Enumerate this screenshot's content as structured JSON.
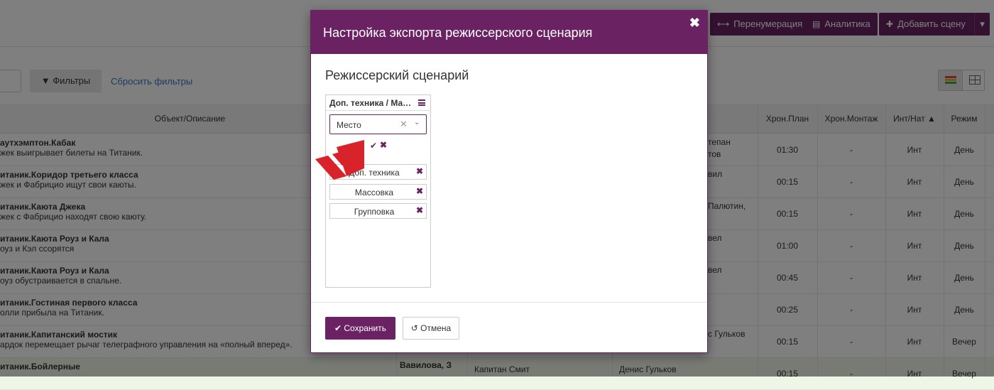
{
  "toolbar": {
    "renumber_label": "Перенумерация",
    "analytics_label": "Аналитика",
    "add_scene_label": "Добавить сцену"
  },
  "filters": {
    "filters_label": "Фильтры",
    "reset_label": "Сбросить фильтры"
  },
  "table": {
    "headers": {
      "object": "Объект/Описание",
      "chron_plan": "Хрон.План",
      "chron_edit": "Хрон.Монтаж",
      "int_nat": "Инт/Нат ▲",
      "mode": "Режим"
    },
    "rows": [
      {
        "title": "аутхэмптон.Кабак",
        "desc": "жек выигрывает билеты на Титаник.",
        "cast": "тепан",
        "cast2": "тов",
        "plan": "01:30",
        "edit": "-",
        "int": "Инт",
        "mode": "День"
      },
      {
        "title": "итаник.Коридор третьего класса",
        "desc": "жек и Фабрицио ищут свои каюты.",
        "cast": "вил",
        "cast2": "",
        "plan": "00:15",
        "edit": "-",
        "int": "Инт",
        "mode": "День"
      },
      {
        "title": "итаник.Каюта Джека",
        "desc": "жек с Фабрицио находят свою каюту.",
        "cast": "Палютин,",
        "cast2": "",
        "plan": "00:15",
        "edit": "-",
        "int": "Инт",
        "mode": "День"
      },
      {
        "title": "итаник.Каюта Роуз и Кала",
        "desc": "оуз и Кэл ссорятся",
        "cast": "вел",
        "cast2": "",
        "plan": "01:00",
        "edit": "-",
        "int": "Инт",
        "mode": "День"
      },
      {
        "title": "итаник.Каюта Роуз и Кала",
        "desc": "оуз обустраивается в спальне.",
        "cast": "вел",
        "cast2": "",
        "plan": "00:45",
        "edit": "-",
        "int": "Инт",
        "mode": "День"
      },
      {
        "title": "итаник.Гостиная первого класса",
        "desc": "олли прибыла на Титаник.",
        "cast": "",
        "cast2": "",
        "plan": "00:25",
        "edit": "-",
        "int": "Инт",
        "mode": "День"
      },
      {
        "title": "итаник.Капитанский мостик",
        "desc": "ардок перемещает рычаг телеграфного управления на «полный вперед».",
        "cast": "с Гульков",
        "cast2": "",
        "plan": "00:15",
        "edit": "-",
        "int": "Инт",
        "mode": "Вечер"
      },
      {
        "title": "итаник.Бойлерные",
        "desc": "",
        "cast": "",
        "cast2": "",
        "plan": "00:15",
        "edit": "-",
        "int": "Инт",
        "mode": "Вечер",
        "extra1": "Вавилова, З",
        "extra2": "Капитан Смит",
        "extra3": "Денис Гульков"
      }
    ]
  },
  "modal": {
    "title": "Настройка экспорта режиссерского сценария",
    "close_symbol": "✖",
    "section_title": "Режиссерский сценарий",
    "column": {
      "title": "Доп. техника / Массовка / Групповка",
      "select_value": "Место",
      "clear_symbol": "✕",
      "tags": [
        "Доп. техника",
        "Массовка",
        "Групповка"
      ]
    },
    "save_label": "Сохранить",
    "cancel_label": "Отмена"
  },
  "colors": {
    "brand": "#6b2263",
    "logo_red": "#d8232a"
  },
  "icons": [
    "arrows-horizontal-icon",
    "table-icon",
    "plus-icon",
    "caret-down-icon",
    "filter-icon",
    "colored-grid-icon",
    "table-view-icon",
    "hamburger-icon",
    "clear-icon",
    "chevron-down-icon",
    "check-icon",
    "close-icon",
    "undo-icon",
    "chevron-logo-icon"
  ]
}
